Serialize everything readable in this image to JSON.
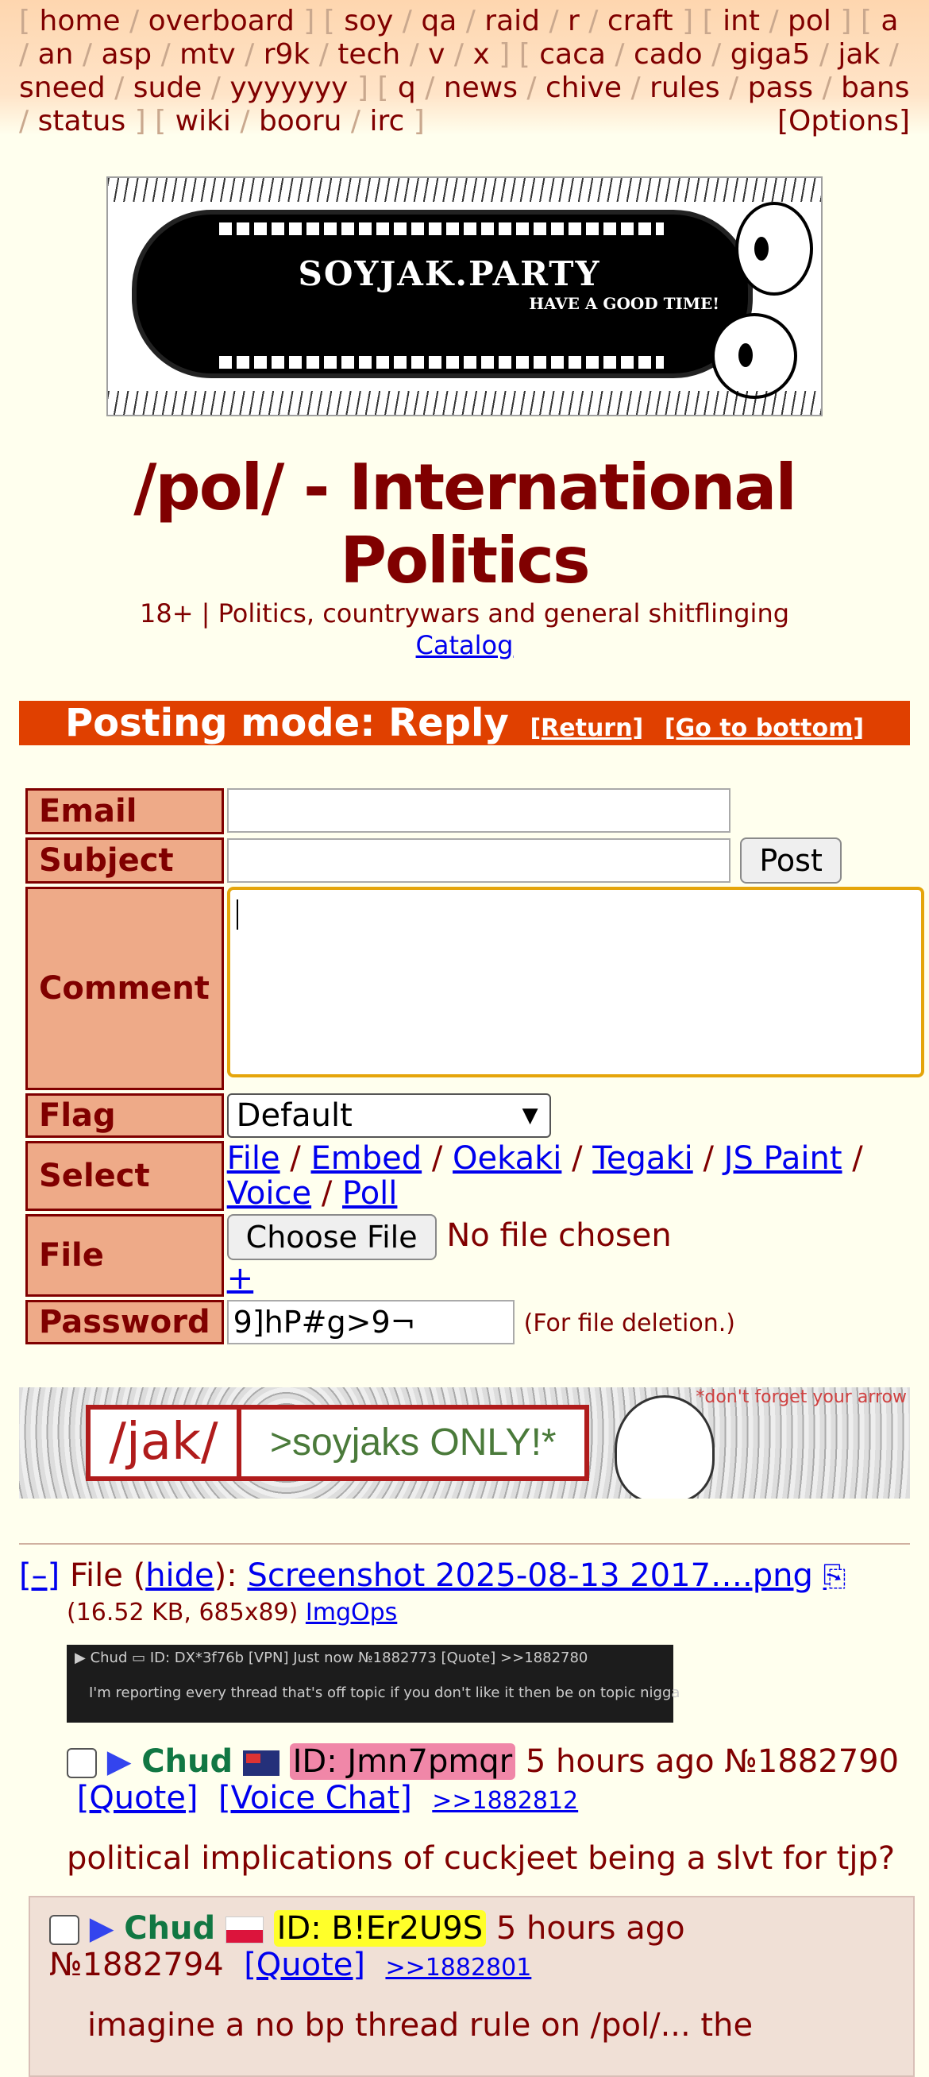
{
  "nav": {
    "group1": [
      "home",
      "overboard"
    ],
    "group2": [
      "soy",
      "qa",
      "raid",
      "r",
      "craft"
    ],
    "group3": [
      "int",
      "pol"
    ],
    "group4": [
      "a",
      "an",
      "asp",
      "mtv",
      "r9k",
      "tech",
      "v",
      "x"
    ],
    "group5": [
      "caca",
      "cado",
      "giga5",
      "jak",
      "sneed",
      "sude",
      "yyyyyyy"
    ],
    "group6": [
      "q",
      "news",
      "chive",
      "rules",
      "pass",
      "bans",
      "status"
    ],
    "group7": [
      "wiki",
      "booru",
      "irc"
    ],
    "options": "[Options]"
  },
  "banner": {
    "title": "SOYJAK.PARTY",
    "tagline": "HAVE A GOOD TIME!"
  },
  "board": {
    "title": "/pol/ - International Politics",
    "subtitle": "18+ | Politics, countrywars and general shitflinging",
    "catalog": "Catalog"
  },
  "posting_mode": {
    "label": "Posting mode: Reply",
    "return": "[Return]",
    "bottom": "[Go to bottom]"
  },
  "form": {
    "email_label": "Email",
    "subject_label": "Subject",
    "post_button": "Post",
    "comment_label": "Comment",
    "flag_label": "Flag",
    "flag_value": "Default",
    "select_label": "Select",
    "select_options": [
      "File",
      "Embed",
      "Oekaki",
      "Tegaki",
      "JS Paint",
      "Voice",
      "Poll"
    ],
    "file_label": "File",
    "choose_file": "Choose File",
    "no_file": "No file chosen",
    "plus": "+",
    "password_label": "Password",
    "password_value": "9]hP#g>9¬",
    "password_note": "(For file deletion.)"
  },
  "ad": {
    "left": "/jak/",
    "right": ">soyjaks ONLY!*",
    "note": "*don't forget your arrow"
  },
  "op": {
    "toggle": "[–]",
    "file_prefix": "File",
    "hide": "hide",
    "filename": "Screenshot 2025-08-13 2017….png",
    "file_meta": "(16.52 KB, 685x89)",
    "imgops": "ImgOps",
    "thumb_line1": "▶ Chud ▭ ID: DX*3f76b [VPN] Just now №1882773 [Quote] >>1882780",
    "thumb_line2": "I'm reporting every thread that's off topic if you don't like it then be on topic nigga",
    "name": "Chud",
    "id": "ID: Jmn7pmqr",
    "time": "5 hours ago",
    "no": "№1882790",
    "quote": "[Quote]",
    "voice": "[Voice Chat]",
    "backlink": ">>1882812",
    "body": "political implications of cuckjeet being a slvt for tjp?"
  },
  "reply": {
    "name": "Chud",
    "id": "ID: B!Er2U9S",
    "time": "5 hours ago",
    "no": "№1882794",
    "quote": "[Quote]",
    "backlink": ">>1882801",
    "body": "imagine a no bp thread rule on /pol/... the"
  }
}
